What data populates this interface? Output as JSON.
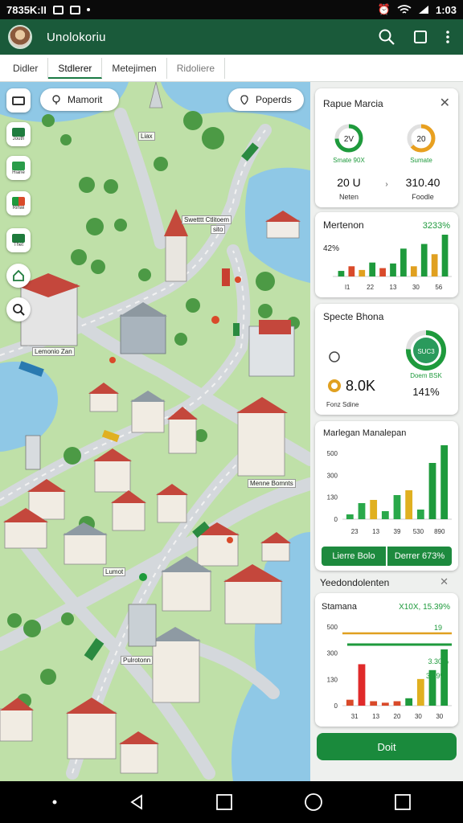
{
  "status_bar": {
    "left_text": "7835K:II",
    "time": "1:03"
  },
  "app_bar": {
    "title": "Unolokoriu"
  },
  "tabs": [
    {
      "label": "Didler"
    },
    {
      "label": "Stdlerer"
    },
    {
      "label": "Metejimen"
    },
    {
      "label": "Ridoliere"
    }
  ],
  "map": {
    "chips": {
      "left_label": "Mamorit",
      "right_label": "Poperds"
    },
    "layer_buttons": [
      {
        "caption": ""
      },
      {
        "caption": "Jouth"
      },
      {
        "caption": "Hiane"
      },
      {
        "caption": "Rihwi"
      },
      {
        "caption": "Thet"
      },
      {
        "caption": ""
      },
      {
        "caption": ""
      }
    ],
    "labels": [
      "Liax",
      "Swetttt Ctlitoem",
      "sito",
      "Lemonio Zan",
      "Menne Bomnts",
      "Lumot",
      "Pulrotonn"
    ]
  },
  "panel": {
    "card1": {
      "title": "Rapue Marcia",
      "gauge_left": {
        "value": "2V",
        "caption": "Smate 90X"
      },
      "gauge_right": {
        "value": "20",
        "caption": "Sumate"
      },
      "stat_left": {
        "value": "20 U",
        "label": "Neten"
      },
      "stat_right": {
        "value": "310.40",
        "label": "Foodle"
      },
      "colors": {
        "gauge_left": "#1e9a3c",
        "gauge_right": "#e8a020"
      }
    },
    "card2": {
      "title": "Mertenon",
      "value": "3233%",
      "ylabel": "42%",
      "chart_data": {
        "type": "bar",
        "categories": [
          "l1",
          "22",
          "13",
          "30",
          "56"
        ],
        "values": [
          12,
          22,
          14,
          30,
          18,
          28,
          60,
          22,
          70,
          48,
          90
        ]
      }
    },
    "card3": {
      "title": "Specte Bhona",
      "value": "8.0K",
      "label": "Fonz Sdine",
      "donut_value": "SUC3",
      "donut_caption": "Doem BSK",
      "percent": "141%"
    },
    "card4": {
      "title": "Marlegan Manalepan",
      "chart_data": {
        "type": "bar",
        "categories": [
          "23",
          "13",
          "39",
          "530",
          "890"
        ],
        "y_ticks": [
          "500",
          "300",
          "130",
          "0"
        ],
        "values": [
          6,
          20,
          24,
          10,
          30,
          36,
          12,
          70,
          92
        ]
      },
      "button_left": "Lierre Bolo",
      "button_right": "Derrer 673%"
    },
    "card5_header": {
      "title": "Yeedondolenten"
    },
    "card5": {
      "title": "Stamana",
      "value": "X10X, 15.39%",
      "legend": "19",
      "value2": "3.30%",
      "value3": "3.39%",
      "chart_data": {
        "type": "bar",
        "categories": [
          "31",
          "13",
          "20",
          "30",
          "30"
        ],
        "y_ticks": [
          "500",
          "300",
          "130",
          "0"
        ],
        "values": [
          8,
          56,
          6,
          4,
          6,
          10,
          36,
          48,
          76
        ]
      }
    },
    "save_button": "Doit"
  }
}
